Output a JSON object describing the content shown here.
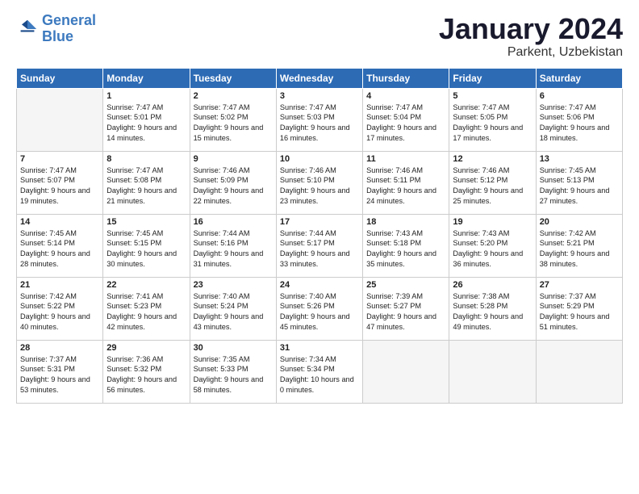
{
  "header": {
    "logo_line1": "General",
    "logo_line2": "Blue",
    "month": "January 2024",
    "location": "Parkent, Uzbekistan"
  },
  "days_of_week": [
    "Sunday",
    "Monday",
    "Tuesday",
    "Wednesday",
    "Thursday",
    "Friday",
    "Saturday"
  ],
  "weeks": [
    [
      {
        "day": null
      },
      {
        "day": 1,
        "sunrise": "7:47 AM",
        "sunset": "5:01 PM",
        "daylight": "9 hours and 14 minutes."
      },
      {
        "day": 2,
        "sunrise": "7:47 AM",
        "sunset": "5:02 PM",
        "daylight": "9 hours and 15 minutes."
      },
      {
        "day": 3,
        "sunrise": "7:47 AM",
        "sunset": "5:03 PM",
        "daylight": "9 hours and 16 minutes."
      },
      {
        "day": 4,
        "sunrise": "7:47 AM",
        "sunset": "5:04 PM",
        "daylight": "9 hours and 17 minutes."
      },
      {
        "day": 5,
        "sunrise": "7:47 AM",
        "sunset": "5:05 PM",
        "daylight": "9 hours and 17 minutes."
      },
      {
        "day": 6,
        "sunrise": "7:47 AM",
        "sunset": "5:06 PM",
        "daylight": "9 hours and 18 minutes."
      }
    ],
    [
      {
        "day": 7,
        "sunrise": "7:47 AM",
        "sunset": "5:07 PM",
        "daylight": "9 hours and 19 minutes."
      },
      {
        "day": 8,
        "sunrise": "7:47 AM",
        "sunset": "5:08 PM",
        "daylight": "9 hours and 21 minutes."
      },
      {
        "day": 9,
        "sunrise": "7:46 AM",
        "sunset": "5:09 PM",
        "daylight": "9 hours and 22 minutes."
      },
      {
        "day": 10,
        "sunrise": "7:46 AM",
        "sunset": "5:10 PM",
        "daylight": "9 hours and 23 minutes."
      },
      {
        "day": 11,
        "sunrise": "7:46 AM",
        "sunset": "5:11 PM",
        "daylight": "9 hours and 24 minutes."
      },
      {
        "day": 12,
        "sunrise": "7:46 AM",
        "sunset": "5:12 PM",
        "daylight": "9 hours and 25 minutes."
      },
      {
        "day": 13,
        "sunrise": "7:45 AM",
        "sunset": "5:13 PM",
        "daylight": "9 hours and 27 minutes."
      }
    ],
    [
      {
        "day": 14,
        "sunrise": "7:45 AM",
        "sunset": "5:14 PM",
        "daylight": "9 hours and 28 minutes."
      },
      {
        "day": 15,
        "sunrise": "7:45 AM",
        "sunset": "5:15 PM",
        "daylight": "9 hours and 30 minutes."
      },
      {
        "day": 16,
        "sunrise": "7:44 AM",
        "sunset": "5:16 PM",
        "daylight": "9 hours and 31 minutes."
      },
      {
        "day": 17,
        "sunrise": "7:44 AM",
        "sunset": "5:17 PM",
        "daylight": "9 hours and 33 minutes."
      },
      {
        "day": 18,
        "sunrise": "7:43 AM",
        "sunset": "5:18 PM",
        "daylight": "9 hours and 35 minutes."
      },
      {
        "day": 19,
        "sunrise": "7:43 AM",
        "sunset": "5:20 PM",
        "daylight": "9 hours and 36 minutes."
      },
      {
        "day": 20,
        "sunrise": "7:42 AM",
        "sunset": "5:21 PM",
        "daylight": "9 hours and 38 minutes."
      }
    ],
    [
      {
        "day": 21,
        "sunrise": "7:42 AM",
        "sunset": "5:22 PM",
        "daylight": "9 hours and 40 minutes."
      },
      {
        "day": 22,
        "sunrise": "7:41 AM",
        "sunset": "5:23 PM",
        "daylight": "9 hours and 42 minutes."
      },
      {
        "day": 23,
        "sunrise": "7:40 AM",
        "sunset": "5:24 PM",
        "daylight": "9 hours and 43 minutes."
      },
      {
        "day": 24,
        "sunrise": "7:40 AM",
        "sunset": "5:26 PM",
        "daylight": "9 hours and 45 minutes."
      },
      {
        "day": 25,
        "sunrise": "7:39 AM",
        "sunset": "5:27 PM",
        "daylight": "9 hours and 47 minutes."
      },
      {
        "day": 26,
        "sunrise": "7:38 AM",
        "sunset": "5:28 PM",
        "daylight": "9 hours and 49 minutes."
      },
      {
        "day": 27,
        "sunrise": "7:37 AM",
        "sunset": "5:29 PM",
        "daylight": "9 hours and 51 minutes."
      }
    ],
    [
      {
        "day": 28,
        "sunrise": "7:37 AM",
        "sunset": "5:31 PM",
        "daylight": "9 hours and 53 minutes."
      },
      {
        "day": 29,
        "sunrise": "7:36 AM",
        "sunset": "5:32 PM",
        "daylight": "9 hours and 56 minutes."
      },
      {
        "day": 30,
        "sunrise": "7:35 AM",
        "sunset": "5:33 PM",
        "daylight": "9 hours and 58 minutes."
      },
      {
        "day": 31,
        "sunrise": "7:34 AM",
        "sunset": "5:34 PM",
        "daylight": "10 hours and 0 minutes."
      },
      {
        "day": null
      },
      {
        "day": null
      },
      {
        "day": null
      }
    ]
  ]
}
